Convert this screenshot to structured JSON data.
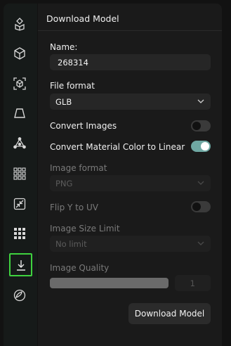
{
  "sidebar": {
    "items": [
      {
        "icon": "shapes-icon"
      },
      {
        "icon": "cube-icon"
      },
      {
        "icon": "cube-focus-icon"
      },
      {
        "icon": "trapezoid-icon"
      },
      {
        "icon": "vertex-icon"
      },
      {
        "icon": "grid-dots-icon"
      },
      {
        "icon": "shrink-icon"
      },
      {
        "icon": "grid-squares-icon"
      },
      {
        "icon": "download-icon",
        "active": true
      },
      {
        "icon": "leaf-icon"
      }
    ],
    "active_color": "#3fd23f"
  },
  "panel": {
    "title": "Download Model",
    "name_label": "Name:",
    "name_value": "268314",
    "file_format_label": "File format",
    "file_format_value": "GLB",
    "convert_images_label": "Convert Images",
    "convert_images_on": false,
    "convert_material_label": "Convert Material Color to Linear",
    "convert_material_on": true,
    "image_format_label": "Image format",
    "image_format_value": "PNG",
    "flip_y_label": "Flip Y to UV",
    "flip_y_on": false,
    "image_size_label": "Image Size Limit",
    "image_size_value": "No limit",
    "image_quality_label": "Image Quality",
    "image_quality_value": "1",
    "download_button": "Download Model"
  },
  "colors": {
    "toggle_on": "#6fa8a3",
    "toggle_off": "#3a3a3a"
  }
}
